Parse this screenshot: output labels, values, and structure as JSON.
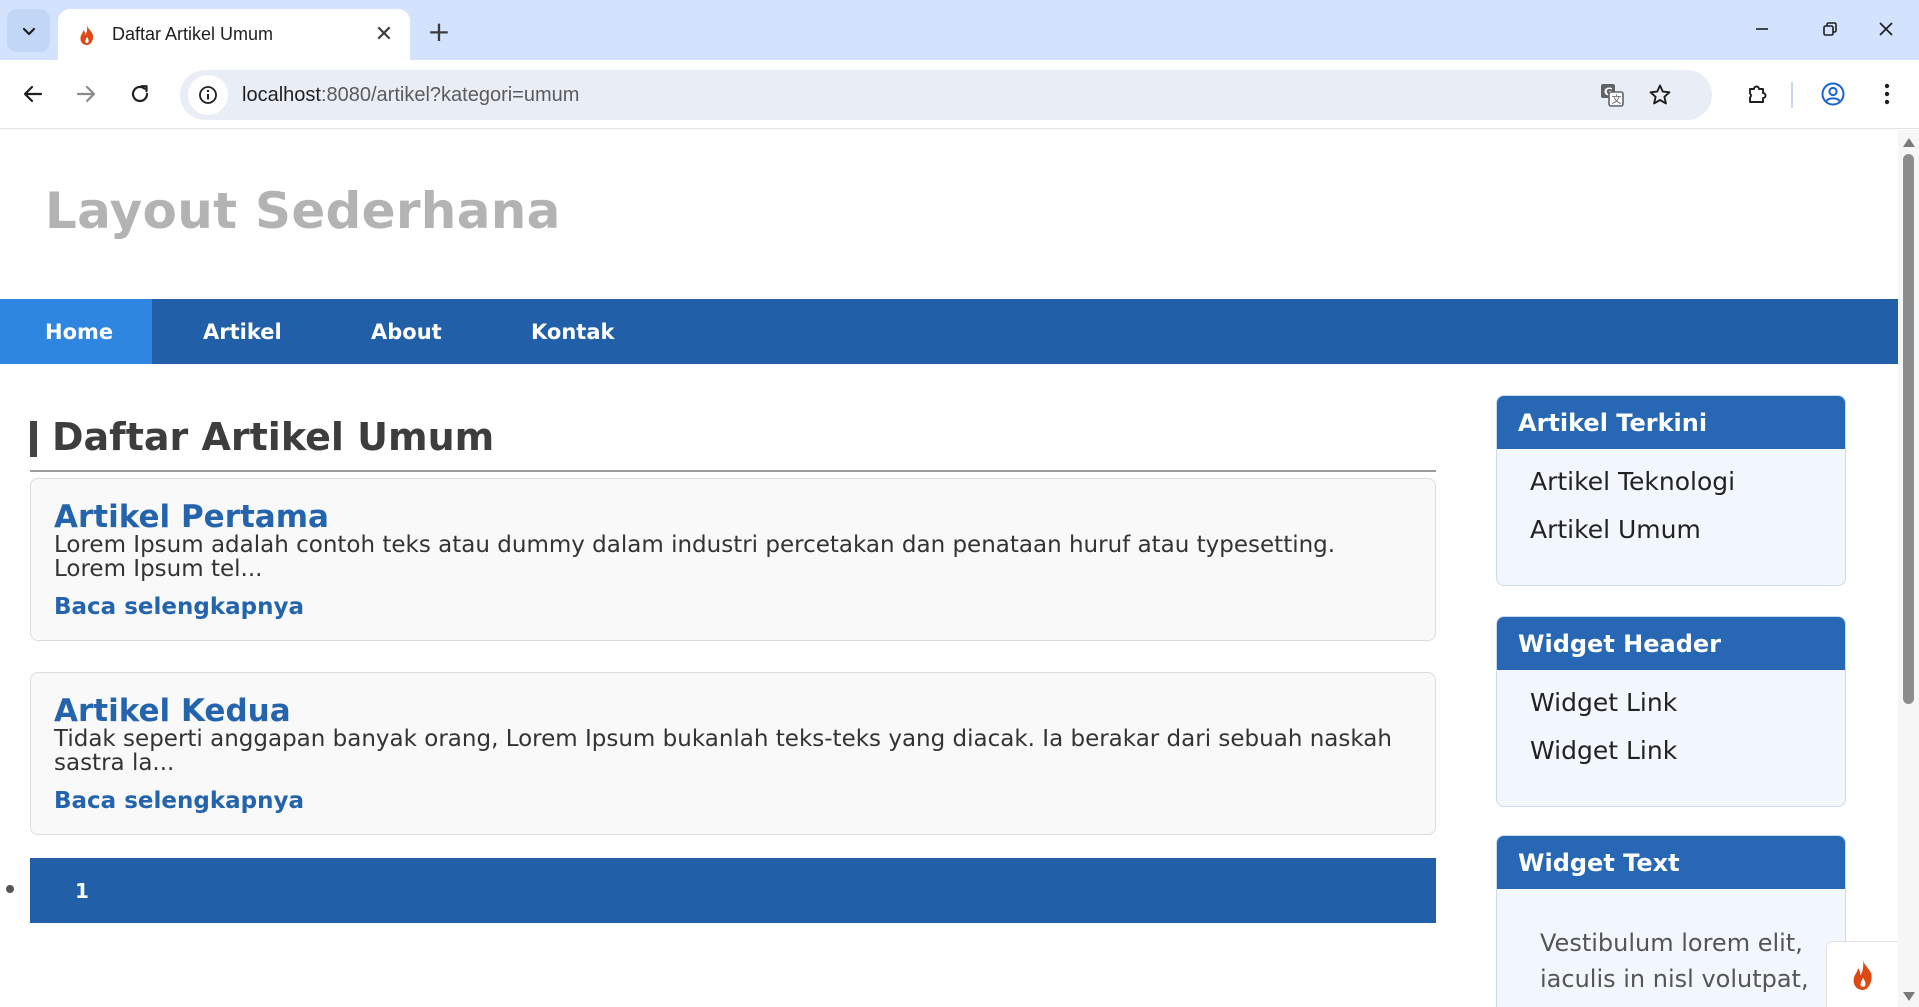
{
  "browser": {
    "tab_title": "Daftar Artikel Umum",
    "tab_close": "✕",
    "new_tab": "+",
    "url_host": "localhost",
    "url_rest": ":8080/artikel?kategori=umum",
    "colors": {
      "tabstrip": "#d3e3fd",
      "omnibox": "#e9eef6"
    }
  },
  "site": {
    "title": "Layout Sederhana",
    "nav": [
      "Home",
      "Artikel",
      "About",
      "Kontak"
    ],
    "active_nav": "Home",
    "colors": {
      "primary": "#2160a9",
      "active": "#2f86e0",
      "link": "#2364ad"
    }
  },
  "main": {
    "heading": "Daftar Artikel Umum",
    "articles": [
      {
        "title": "Artikel Pertama",
        "excerpt": "Lorem Ipsum adalah contoh teks atau dummy dalam industri percetakan dan penataan huruf atau typesetting. Lorem Ipsum tel...",
        "link": "Baca selengkapnya"
      },
      {
        "title": "Artikel Kedua",
        "excerpt": "Tidak seperti anggapan banyak orang, Lorem Ipsum bukanlah teks-teks yang diacak. Ia berakar dari sebuah naskah sastra la...",
        "link": "Baca selengkapnya"
      }
    ],
    "pagination": {
      "current_page": "1"
    }
  },
  "sidebar": {
    "widgets": [
      {
        "title": "Artikel Terkini",
        "links": [
          "Artikel Teknologi",
          "Artikel Umum"
        ]
      },
      {
        "title": "Widget Header",
        "links": [
          "Widget Link",
          "Widget Link"
        ]
      },
      {
        "title": "Widget Text",
        "text": "Vestibulum lorem elit, iaculis in nisl volutpat,"
      }
    ]
  }
}
